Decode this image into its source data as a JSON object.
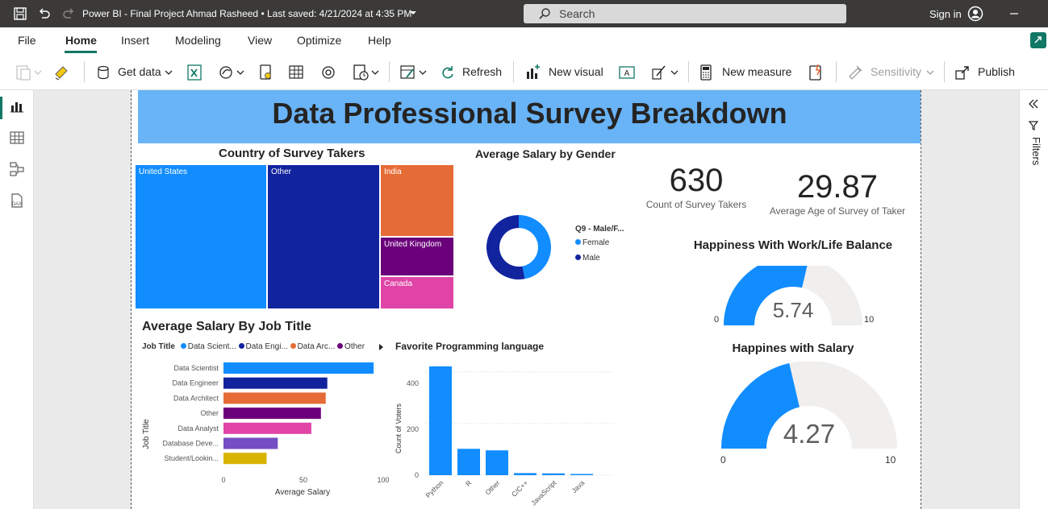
{
  "titlebar": {
    "title": "Power BI - Final Project Ahmad Rasheed • Last saved: 4/21/2024 at 4:35 PM",
    "search_placeholder": "Search",
    "signin": "Sign in"
  },
  "menu": {
    "file": "File",
    "home": "Home",
    "insert": "Insert",
    "modeling": "Modeling",
    "view": "View",
    "optimize": "Optimize",
    "help": "Help"
  },
  "ribbon": {
    "get_data": "Get data",
    "refresh": "Refresh",
    "new_visual": "New visual",
    "new_measure": "New measure",
    "sensitivity": "Sensitivity",
    "publish": "Publish"
  },
  "rightpane": {
    "filters": "Filters"
  },
  "report": {
    "title": "Data Professional Survey Breakdown",
    "treemap": {
      "title": "Country of Survey Takers",
      "items": [
        {
          "label": "United States",
          "color": "#118dff"
        },
        {
          "label": "Other",
          "color": "#12239e"
        },
        {
          "label": "India",
          "color": "#e66c37"
        },
        {
          "label": "United Kingdom",
          "color": "#6b007b"
        },
        {
          "label": "Canada",
          "color": "#e044a7"
        }
      ]
    },
    "donut": {
      "title": "Average Salary by Gender",
      "legend_title": "Q9 - Male/F...",
      "legend": [
        {
          "label": "Female",
          "color": "#118dff"
        },
        {
          "label": "Male",
          "color": "#12239e"
        }
      ]
    },
    "kpi_count": {
      "value": "630",
      "label": "Count of Survey Takers"
    },
    "kpi_age": {
      "value": "29.87",
      "label": "Average Age of Survey of Taker"
    },
    "gauge_wlb": {
      "title": "Happiness With Work/Life Balance",
      "value": "5.74",
      "min": "0",
      "max": "10"
    },
    "gauge_salary": {
      "title": "Happines with Salary",
      "value": "4.27",
      "min": "0",
      "max": "10"
    },
    "bar_job": {
      "title": "Average Salary By Job Title",
      "legend_title": "Job Title",
      "legend": [
        {
          "label": "Data Scient...",
          "color": "#118dff"
        },
        {
          "label": "Data Engi...",
          "color": "#12239e"
        },
        {
          "label": "Data Arc...",
          "color": "#e66c37"
        },
        {
          "label": "Other",
          "color": "#6b007b"
        }
      ],
      "ylabel": "Job Title",
      "xlabel": "Average Salary",
      "x_ticks": [
        "0",
        "50",
        "100"
      ]
    },
    "column_lang": {
      "title": "Favorite Programming language",
      "ylabel": "Count of Voters",
      "y_ticks": [
        "0",
        "200",
        "400"
      ]
    }
  },
  "chart_data": [
    {
      "type": "bar",
      "title": "Average Salary By Job Title",
      "xlabel": "Average Salary",
      "ylabel": "Job Title",
      "xlim": [
        0,
        100
      ],
      "categories": [
        "Data Scientist",
        "Data Engineer",
        "Data Architect",
        "Other",
        "Data Analyst",
        "Database Deve...",
        "Student/Lookin..."
      ],
      "values": [
        94,
        65,
        64,
        61,
        55,
        34,
        27
      ],
      "colors": [
        "#118dff",
        "#12239e",
        "#e66c37",
        "#6b007b",
        "#e044a7",
        "#744ec2",
        "#d9b300"
      ]
    },
    {
      "type": "bar",
      "title": "Favorite Programming language",
      "ylabel": "Count of Voters",
      "ylim": [
        0,
        430
      ],
      "categories": [
        "Python",
        "R",
        "Other",
        "C/C++",
        "JavaScript",
        "Java"
      ],
      "values": [
        421,
        102,
        96,
        8,
        7,
        4
      ],
      "color": "#118dff"
    },
    {
      "type": "pie",
      "title": "Average Salary by Gender",
      "categories": [
        "Female",
        "Male"
      ],
      "values": [
        47,
        53
      ]
    }
  ]
}
